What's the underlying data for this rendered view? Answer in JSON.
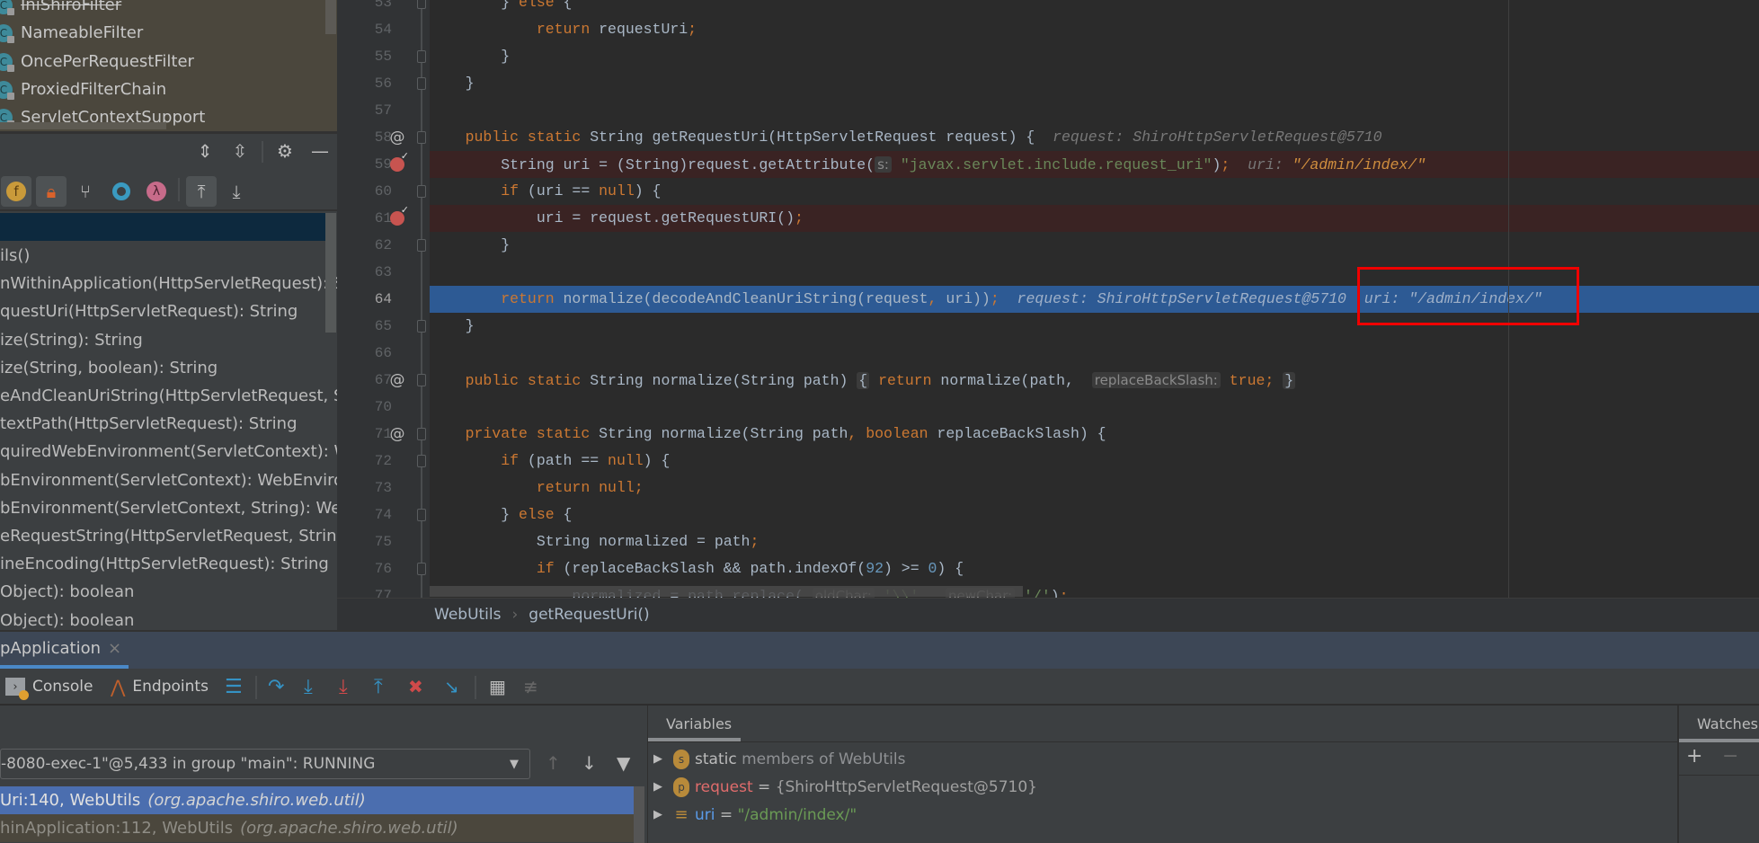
{
  "structure_top": {
    "items": [
      {
        "label": "IniShiroFilter",
        "deprecated": true
      },
      {
        "label": "NameableFilter"
      },
      {
        "label": "OncePerRequestFilter"
      },
      {
        "label": "ProxiedFilterChain"
      },
      {
        "label": "ServletContextSupport"
      }
    ],
    "class_icon": "C"
  },
  "structure_toolbar": {
    "icons": [
      "expand-all-icon",
      "collapse-all-icon",
      "gear-icon",
      "minimize-icon"
    ],
    "filters": [
      "show-fields-icon",
      "show-non-public-icon",
      "show-inherited-icon",
      "show-anonymous-icon",
      "show-lambdas-icon",
      "autoscroll-to-source-icon",
      "autoscroll-from-source-icon"
    ],
    "field_glyph": "f",
    "lambda_glyph": "λ"
  },
  "structure_list": [
    "ils()",
    "nWithinApplication(HttpServletRequest): Str",
    "questUri(HttpServletRequest): String",
    "ize(String): String",
    "ize(String, boolean): String",
    "eAndCleanUriString(HttpServletRequest, Stri",
    "textPath(HttpServletRequest): String",
    "quiredWebEnvironment(ServletContext): Web",
    "bEnvironment(ServletContext): WebEnvironm",
    "bEnvironment(ServletContext, String): WebE",
    "eRequestString(HttpServletRequest, String):",
    "ineEncoding(HttpServletRequest): String",
    "Object): boolean",
    "Object): boolean"
  ],
  "editor": {
    "current_line": "64",
    "lines": [
      {
        "n": "53",
        "fold": "end",
        "tokens": [
          [
            "t",
            "        } "
          ],
          [
            "k",
            "else "
          ],
          [
            "t",
            "{"
          ]
        ]
      },
      {
        "n": "54",
        "tokens": [
          [
            "k",
            "            return "
          ],
          [
            "t",
            "requestUri"
          ],
          [
            "k",
            ";"
          ]
        ]
      },
      {
        "n": "55",
        "fold": "end",
        "tokens": [
          [
            "t",
            "        }"
          ]
        ]
      },
      {
        "n": "56",
        "fold": "end",
        "tokens": [
          [
            "t",
            "    }"
          ]
        ]
      },
      {
        "n": "57",
        "tokens": []
      },
      {
        "n": "58",
        "mark": "@",
        "fold": "start",
        "tokens": [
          [
            "k",
            "    public static "
          ],
          [
            "t",
            "String getRequestUri(HttpServletRequest request) {  "
          ],
          [
            "i",
            "request: ShiroHttpServletRequest@5710"
          ]
        ]
      },
      {
        "n": "59",
        "mark": "breakpoint",
        "bg": "bp",
        "tokens": [
          [
            "t",
            "        String uri = (String)request.getAttribute("
          ],
          [
            "h",
            "s:"
          ],
          [
            "s",
            " \"javax.servlet.include.request_uri\""
          ],
          [
            "t",
            ")"
          ],
          [
            "k",
            ";  "
          ],
          [
            "i",
            "uri: "
          ],
          [
            "v",
            "\"/admin/index/\""
          ]
        ]
      },
      {
        "n": "60",
        "fold": "start",
        "tokens": [
          [
            "k",
            "        if "
          ],
          [
            "t",
            "(uri == "
          ],
          [
            "k",
            "null"
          ],
          [
            "t",
            ") {"
          ]
        ]
      },
      {
        "n": "61",
        "mark": "breakpoint",
        "bg": "bp",
        "tokens": [
          [
            "t",
            "            uri = request.getRequestURI()"
          ],
          [
            "k",
            ";"
          ]
        ]
      },
      {
        "n": "62",
        "fold": "end",
        "tokens": [
          [
            "t",
            "        }"
          ]
        ]
      },
      {
        "n": "63",
        "tokens": []
      },
      {
        "n": "64",
        "bg": "exec",
        "tokens": [
          [
            "k",
            "        return "
          ],
          [
            "t",
            "normalize(decodeAndCleanUriString(request"
          ],
          [
            "k",
            ", "
          ],
          [
            "t",
            "uri))"
          ],
          [
            "k",
            ";  "
          ],
          [
            "i",
            "request: ShiroHttpServletRequest@5710  uri: \"/admin/index/\""
          ]
        ]
      },
      {
        "n": "65",
        "fold": "end",
        "tokens": [
          [
            "t",
            "    }"
          ]
        ]
      },
      {
        "n": "66",
        "tokens": []
      },
      {
        "n": "67",
        "mark": "@",
        "fold": "plus",
        "tokens": [
          [
            "k",
            "    public static "
          ],
          [
            "t",
            "String normalize(String path) "
          ],
          [
            "fb",
            "{"
          ],
          [
            "t",
            " "
          ],
          [
            "k",
            "return "
          ],
          [
            "t",
            "normalize(path,  "
          ],
          [
            "h",
            "replaceBackSlash:"
          ],
          [
            "t",
            " "
          ],
          [
            "k",
            "true"
          ],
          [
            "k",
            ";"
          ],
          [
            "t",
            " "
          ],
          [
            "fb",
            "}"
          ]
        ]
      },
      {
        "n": "70",
        "tokens": []
      },
      {
        "n": "71",
        "mark": "@",
        "fold": "start",
        "tokens": [
          [
            "k",
            "    private static "
          ],
          [
            "t",
            "String normalize(String path"
          ],
          [
            "k",
            ", boolean "
          ],
          [
            "t",
            "replaceBackSlash) {"
          ]
        ]
      },
      {
        "n": "72",
        "fold": "start",
        "tokens": [
          [
            "k",
            "        if "
          ],
          [
            "t",
            "(path == "
          ],
          [
            "k",
            "null"
          ],
          [
            "t",
            ") {"
          ]
        ]
      },
      {
        "n": "73",
        "tokens": [
          [
            "k",
            "            return null;"
          ]
        ]
      },
      {
        "n": "74",
        "fold": "end",
        "tokens": [
          [
            "t",
            "        } "
          ],
          [
            "k",
            "else "
          ],
          [
            "t",
            "{"
          ]
        ]
      },
      {
        "n": "75",
        "tokens": [
          [
            "t",
            "            String normalized = path"
          ],
          [
            "k",
            ";"
          ]
        ]
      },
      {
        "n": "76",
        "fold": "start",
        "tokens": [
          [
            "k",
            "            if "
          ],
          [
            "t",
            "(replaceBackSlash && path.indexOf("
          ],
          [
            "n",
            "92"
          ],
          [
            "t",
            ") >= "
          ],
          [
            "n",
            "0"
          ],
          [
            "t",
            ") {"
          ]
        ]
      },
      {
        "n": "77",
        "tokens": [
          [
            "t",
            "                normalized = path.replace( "
          ],
          [
            "h",
            "oldChar:"
          ],
          [
            "s",
            " '\\\\'"
          ],
          [
            "k",
            ",  "
          ],
          [
            "h",
            "newChar:"
          ],
          [
            "s",
            " '/'"
          ],
          [
            "t",
            ")"
          ],
          [
            "k",
            ";"
          ]
        ]
      }
    ]
  },
  "breadcrumb": {
    "items": [
      "WebUtils",
      "getRequestUri()"
    ],
    "separator": "›"
  },
  "debug": {
    "tab_label": "pApplication",
    "tab_close": "×",
    "toolbar": {
      "console_label": "Console",
      "endpoints_label": "Endpoints",
      "icons": [
        "restore-layout-icon",
        "step-over-icon",
        "step-into-icon",
        "force-step-into-icon",
        "step-out-icon",
        "drop-frame-icon",
        "run-to-cursor-icon",
        "evaluate-expression-icon",
        "trace-stream-icon"
      ]
    },
    "frames": {
      "thread": "-8080-exec-1\"@5,433 in group \"main\": RUNNING",
      "rows": [
        {
          "method": "Uri:140, WebUtils",
          "package": "(org.apache.shiro.web.util)",
          "selected": true
        },
        {
          "method": "hinApplication:112, WebUtils",
          "package": "(org.apache.shiro.web.util)",
          "selected": false
        }
      ]
    },
    "variables": {
      "tab_label": "Variables",
      "rows": [
        {
          "icon": "s",
          "name": "static",
          "eq": "",
          "value": " members of WebUtils"
        },
        {
          "icon": "p",
          "name": "request",
          "eq": " = ",
          "value": "{ShiroHttpServletRequest@5710}"
        },
        {
          "icon": "field",
          "name": "uri",
          "eq": " = ",
          "value": "\"/admin/index/\""
        }
      ]
    },
    "watches": {
      "tab_label": "Watches",
      "add": "+",
      "remove": "−"
    }
  },
  "colors": {
    "keyword": "#cc7832",
    "string": "#6a8759",
    "execution_line": "#2d5a94",
    "breakpoint_line": "#3a2323",
    "highlight_box": "#f00000"
  }
}
